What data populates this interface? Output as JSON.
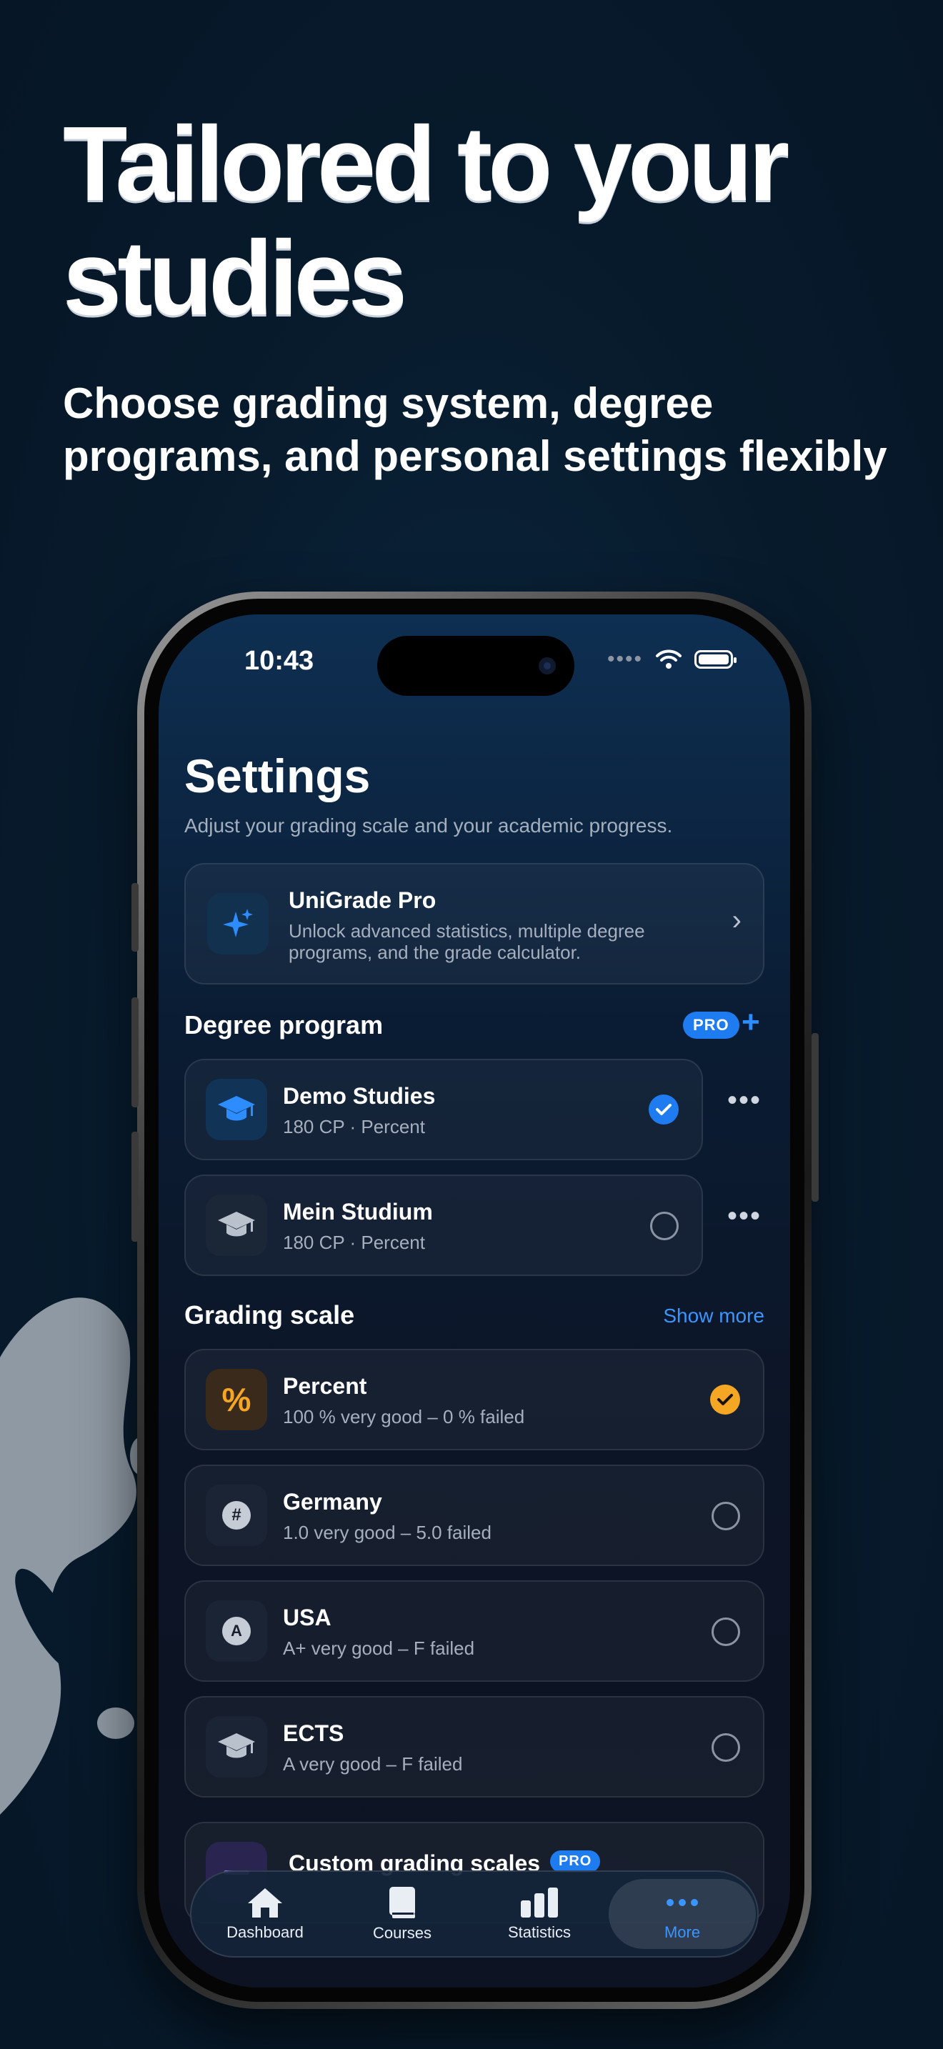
{
  "headline": "Tailored to your studies",
  "subheadline": "Choose grading system, degree programs, and personal settings flexibly",
  "status_bar": {
    "time": "10:43"
  },
  "settings": {
    "title": "Settings",
    "description": "Adjust your grading scale and your academic progress.",
    "pro_card": {
      "title": "UniGrade Pro",
      "subtitle_line1": "Unlock advanced statistics, multiple degree",
      "subtitle_line2": "programs, and the grade calculator."
    },
    "degree_section": {
      "title": "Degree program",
      "badge": "PRO",
      "items": [
        {
          "name": "Demo Studies",
          "detail": "180 CP · Percent",
          "selected": true
        },
        {
          "name": "Mein Studium",
          "detail": "180 CP · Percent",
          "selected": false
        }
      ]
    },
    "grading_section": {
      "title": "Grading scale",
      "show_more": "Show more",
      "items": [
        {
          "name": "Percent",
          "detail": "100 % very good – 0 % failed",
          "icon": "percent-icon",
          "selected": true
        },
        {
          "name": "Germany",
          "detail": "1.0 very good – 5.0 failed",
          "icon": "hash-icon",
          "selected": false
        },
        {
          "name": "USA",
          "detail": "A+ very good – F failed",
          "icon": "letter-a-icon",
          "selected": false
        },
        {
          "name": "ECTS",
          "detail": "A very good – F failed",
          "icon": "graduation-cap-icon",
          "selected": false
        }
      ]
    },
    "custom_scales": {
      "title": "Custom grading scales",
      "badge": "PRO"
    }
  },
  "tab_bar": {
    "active": "More",
    "tabs": [
      {
        "label": "Dashboard",
        "icon": "home-icon"
      },
      {
        "label": "Courses",
        "icon": "book-icon"
      },
      {
        "label": "Statistics",
        "icon": "chart-icon"
      },
      {
        "label": "More",
        "icon": "ellipsis-icon"
      }
    ]
  },
  "colors": {
    "background": "#071a2b",
    "accent_blue": "#1f7cf0",
    "accent_orange": "#f5a623"
  }
}
